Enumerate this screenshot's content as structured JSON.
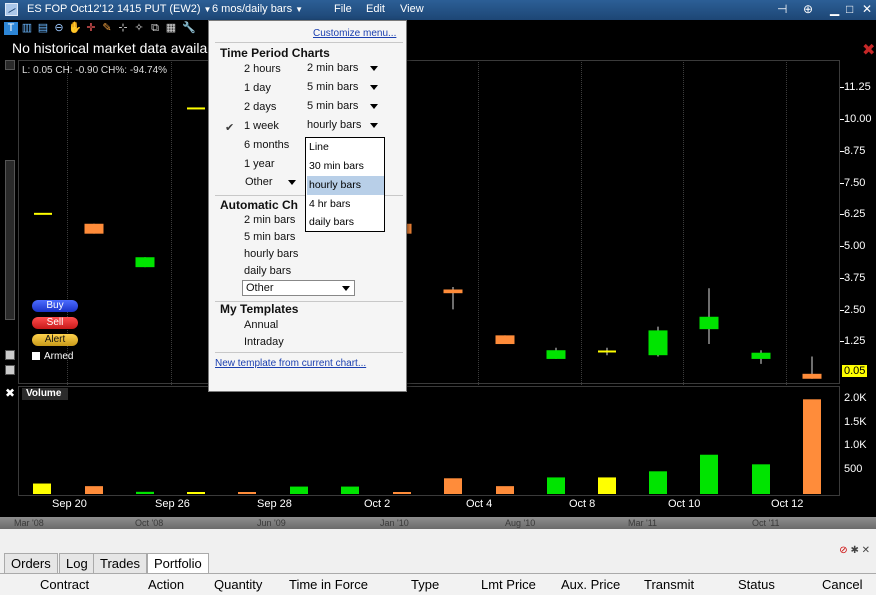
{
  "window": {
    "instrument": "ES FOP Oct12'12 1415 PUT (EW2)",
    "timeframe": "6 mos/daily bars",
    "menus": [
      "File",
      "Edit",
      "View"
    ]
  },
  "message": "No historical market data available p",
  "stats": "L: 0.05  CH: -0.90  CH%: -94.74%",
  "price_axis": {
    "ticks": [
      "11.25",
      "10.00",
      "8.75",
      "7.50",
      "6.25",
      "5.00",
      "3.75",
      "2.50",
      "1.25"
    ],
    "last": "0.05"
  },
  "volume_panel": {
    "label": "Volume",
    "ticks": [
      "2.0K",
      "1.5K",
      "1.0K",
      "500"
    ]
  },
  "order_buttons": {
    "buy": "Buy",
    "sell": "Sell",
    "alert": "Alert",
    "armed": "Armed"
  },
  "x_labels": [
    "Sep 20",
    "Sep 26",
    "Sep 28",
    "Oct 2",
    "Oct 4",
    "Oct 8",
    "Oct 10",
    "Oct 12"
  ],
  "overview_labels": [
    "Mar '08",
    "Oct '08",
    "Jun '09",
    "Jan '10",
    "Aug '10",
    "Mar '11",
    "Oct '11"
  ],
  "chart_data": {
    "type": "candlestick",
    "ylim": [
      0,
      12.5
    ],
    "candles": [
      {
        "open": 6.7,
        "close": 6.7,
        "high": 6.7,
        "low": 6.7,
        "color": "#ffff00"
      },
      {
        "open": 6.3,
        "close": 5.9,
        "high": 6.3,
        "low": 5.9,
        "color": "#ff8c3a"
      },
      {
        "open": 4.55,
        "close": 4.95,
        "high": 4.95,
        "low": 4.55,
        "color": "#00e400"
      },
      {
        "open": 10.95,
        "close": 10.95,
        "high": 10.95,
        "low": 10.95,
        "color": "#ffff00"
      },
      {
        "open": 6.3,
        "close": 5.9,
        "high": 6.3,
        "low": 5.9,
        "color": "#ff8c3a"
      },
      {
        "open": 3.65,
        "close": 3.5,
        "high": 3.75,
        "low": 2.85,
        "color": "#ff8c3a"
      },
      {
        "open": 1.8,
        "close": 1.45,
        "high": 1.8,
        "low": 1.45,
        "color": "#ff8c3a"
      },
      {
        "open": 0.85,
        "close": 1.2,
        "high": 1.3,
        "low": 0.85,
        "color": "#00e400"
      },
      {
        "open": 1.15,
        "close": 1.15,
        "high": 1.3,
        "low": 1.0,
        "color": "#ffff00"
      },
      {
        "open": 1.0,
        "close": 2.0,
        "high": 2.15,
        "low": 0.95,
        "color": "#00e400"
      },
      {
        "open": 2.05,
        "close": 2.55,
        "high": 3.7,
        "low": 1.45,
        "color": "#00e400"
      },
      {
        "open": 0.85,
        "close": 1.1,
        "high": 1.2,
        "low": 0.65,
        "color": "#00e400"
      },
      {
        "open": 0.25,
        "close": 0.05,
        "high": 0.95,
        "low": 0.05,
        "color": "#ff8c3a"
      }
    ],
    "volume": [
      {
        "value": 240,
        "color": "#ffff00"
      },
      {
        "value": 180,
        "color": "#ff8c3a"
      },
      {
        "value": 50,
        "color": "#00e400"
      },
      {
        "value": 40,
        "color": "#ffff00"
      },
      {
        "value": 20,
        "color": "#ff8c3a"
      },
      {
        "value": 170,
        "color": "#00e400"
      },
      {
        "value": 170,
        "color": "#00e400"
      },
      {
        "value": 20,
        "color": "#ff8c3a"
      },
      {
        "value": 360,
        "color": "#ff8c3a"
      },
      {
        "value": 180,
        "color": "#ff8c3a"
      },
      {
        "value": 380,
        "color": "#00e400"
      },
      {
        "value": 380,
        "color": "#ffff00"
      },
      {
        "value": 520,
        "color": "#00e400"
      },
      {
        "value": 900,
        "color": "#00e400"
      },
      {
        "value": 680,
        "color": "#00e400"
      },
      {
        "value": 2170,
        "color": "#ff8c3a"
      }
    ],
    "volume_ylim": [
      0,
      2200
    ]
  },
  "menu": {
    "customize": "Customize menu...",
    "time_period_title": "Time Period Charts",
    "time_periods": [
      {
        "label": "2 hours",
        "bar": "2 min bars"
      },
      {
        "label": "1 day",
        "bar": "5 min bars"
      },
      {
        "label": "2 days",
        "bar": "5 min bars"
      },
      {
        "label": "1 week",
        "bar": "hourly bars"
      },
      {
        "label": "6 months",
        "bar": ""
      },
      {
        "label": "1 year",
        "bar": ""
      }
    ],
    "other": "Other",
    "automatic_title": "Automatic Ch",
    "automatic_items": [
      "2 min bars",
      "5 min bars",
      "hourly bars",
      "daily bars"
    ],
    "automatic_other": "Other",
    "templates_title": "My Templates",
    "templates": [
      "Annual",
      "Intraday"
    ],
    "new_template": "New template from current chart..."
  },
  "dropdown_options": [
    "Line",
    "30 min bars",
    "hourly bars",
    "4 hr bars",
    "daily bars"
  ],
  "bottom": {
    "tabs": [
      "Orders",
      "Log",
      "Trades",
      "Portfolio"
    ],
    "columns": [
      "Contract",
      "Action",
      "Quantity",
      "Time in Force",
      "Type",
      "Lmt Price",
      "Aux. Price",
      "Transmit",
      "Status",
      "Cancel"
    ]
  }
}
